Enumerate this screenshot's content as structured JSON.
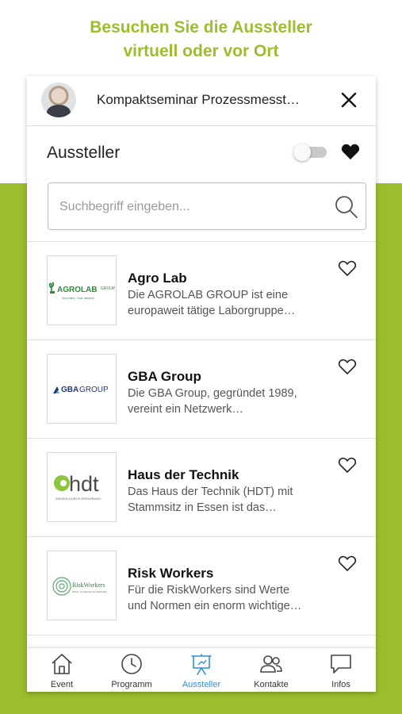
{
  "promo": {
    "line1": "Besuchen Sie die Aussteller",
    "line2": "virtuell oder vor Ort"
  },
  "topbar": {
    "event_title": "Kompaktseminar Prozessmesst…"
  },
  "section": {
    "title": "Aussteller",
    "favorites_toggle_on": false
  },
  "search": {
    "placeholder": "Suchbegriff eingeben...",
    "value": ""
  },
  "exhibitors": [
    {
      "name": "Agro Lab",
      "description": "Die AGROLAB GROUP ist eine europaweit tätige Laborgruppe…",
      "logo_text": "AGROLAB",
      "logo_suffix": "GROUP",
      "logo_tagline": "Your labs. Your service."
    },
    {
      "name": "GBA Group",
      "description": "Die GBA Group, gegründet 1989, vereint ein Netzwerk…",
      "logo_text": "GBA",
      "logo_suffix": "GROUP"
    },
    {
      "name": "Haus der Technik",
      "description": "Das Haus der Technik (HDT) mit Stammsitz in Essen ist das…",
      "logo_text": "hdt",
      "logo_tagline": "WISSEN DURCH ERFAHRUNG"
    },
    {
      "name": "Risk Workers",
      "description": "Für die RiskWorkers sind Werte und Normen ein enorm wichtige…",
      "logo_text": "RiskWorkers",
      "logo_tagline": "Sicher. Im Wert für die Sicherheit"
    }
  ],
  "nav": [
    {
      "label": "Event",
      "icon": "home-icon",
      "active": false
    },
    {
      "label": "Programm",
      "icon": "clock-icon",
      "active": false
    },
    {
      "label": "Aussteller",
      "icon": "presentation-icon",
      "active": true
    },
    {
      "label": "Kontakte",
      "icon": "contacts-icon",
      "active": false
    },
    {
      "label": "Infos",
      "icon": "chat-icon",
      "active": false
    }
  ],
  "colors": {
    "brand_green": "#9cbd2d",
    "active_blue": "#2f8fd8"
  }
}
